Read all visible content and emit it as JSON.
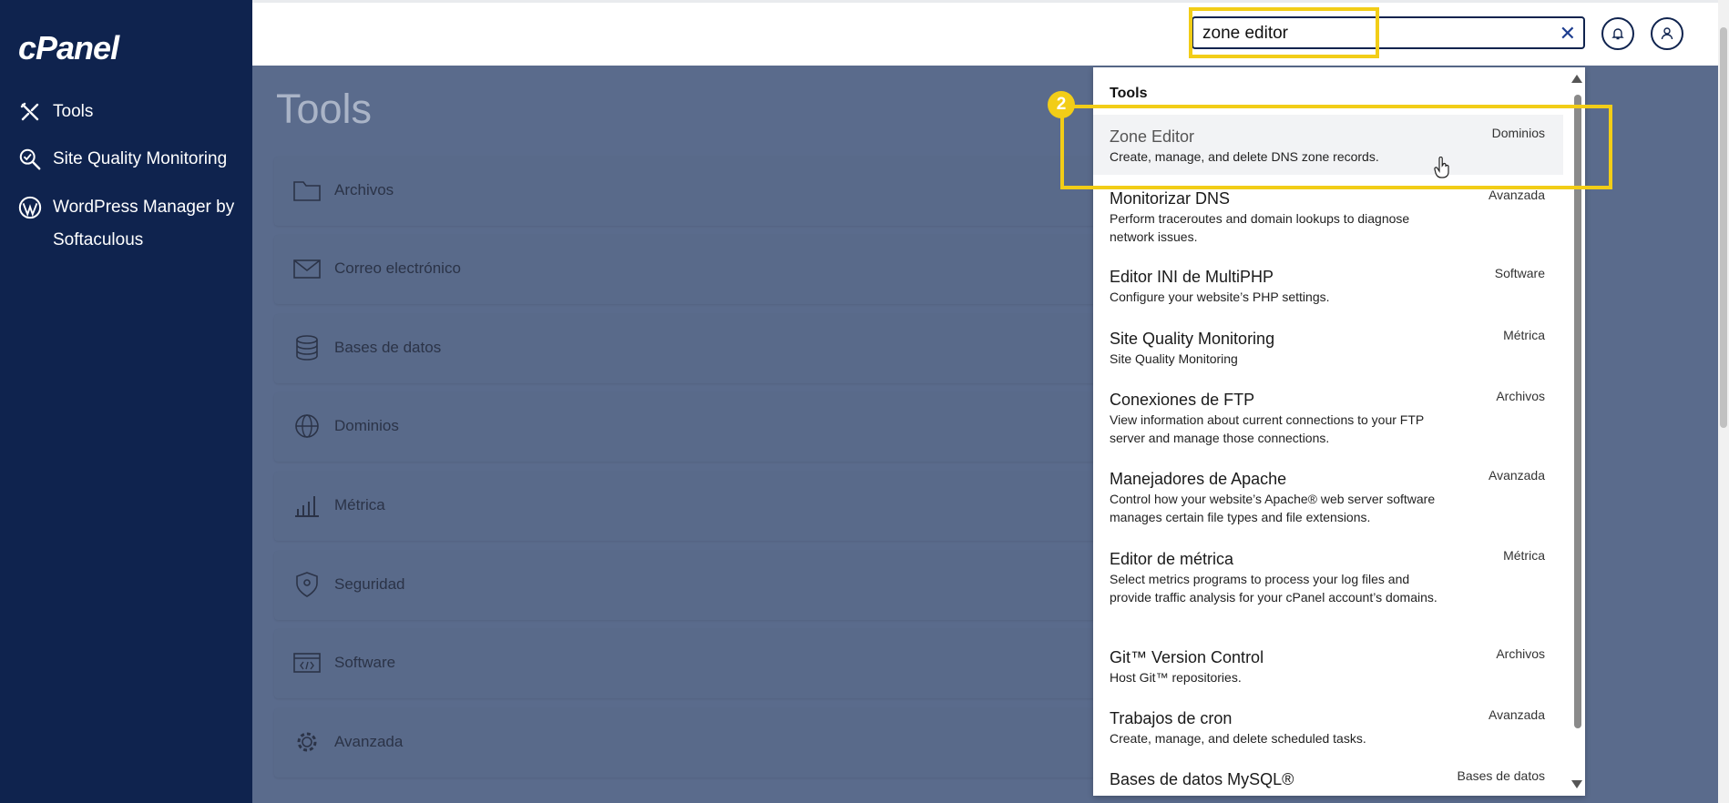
{
  "brand": {
    "logo": "cPanel"
  },
  "sidebar": {
    "items": [
      {
        "label": "Tools",
        "icon": "tools-icon"
      },
      {
        "label": "Site Quality Monitoring",
        "icon": "magnifier-check-icon"
      },
      {
        "label": "WordPress Manager by Softaculous",
        "icon": "wordpress-icon"
      }
    ]
  },
  "search": {
    "value": "zone editor",
    "placeholder": ""
  },
  "main": {
    "title": "Tools",
    "sections": [
      {
        "label": "Archivos",
        "icon": "folder-icon"
      },
      {
        "label": "Correo electrónico",
        "icon": "envelope-icon"
      },
      {
        "label": "Bases de datos",
        "icon": "database-icon"
      },
      {
        "label": "Dominios",
        "icon": "globe-icon"
      },
      {
        "label": "Métrica",
        "icon": "bar-chart-icon"
      },
      {
        "label": "Seguridad",
        "icon": "shield-icon"
      },
      {
        "label": "Software",
        "icon": "code-window-icon"
      },
      {
        "label": "Avanzada",
        "icon": "gear-icon"
      }
    ]
  },
  "dropdown": {
    "heading": "Tools",
    "items": [
      {
        "title": "Zone Editor",
        "desc": "Create, manage, and delete DNS zone records.",
        "category": "Dominios"
      },
      {
        "title": "Monitorizar DNS",
        "desc": "Perform traceroutes and domain lookups to diagnose network issues.",
        "category": "Avanzada"
      },
      {
        "title": "Editor INI de MultiPHP",
        "desc": "Configure your website’s PHP settings.",
        "category": "Software"
      },
      {
        "title": "Site Quality Monitoring",
        "desc": "Site Quality Monitoring",
        "category": "Métrica"
      },
      {
        "title": "Conexiones de FTP",
        "desc": "View information about current connections to your FTP server and manage those connections.",
        "category": "Archivos"
      },
      {
        "title": "Manejadores de Apache",
        "desc": "Control how your website’s Apache® web server software manages certain file types and file extensions.",
        "category": "Avanzada"
      },
      {
        "title": "Editor de métrica",
        "desc": "Select metrics programs to process your log files and provide traffic analysis for your cPanel account’s domains.",
        "category": "Métrica"
      },
      {
        "title": "Git™ Version Control",
        "desc": "Host Git™ repositories.",
        "category": "Archivos"
      },
      {
        "title": "Trabajos de cron",
        "desc": "Create, manage, and delete scheduled tasks.",
        "category": "Avanzada"
      },
      {
        "title": "Bases de datos MySQL®",
        "desc": "",
        "category": "Bases de datos"
      }
    ]
  },
  "annotation": {
    "step": "2"
  },
  "colors": {
    "sidebar": "#0f234e",
    "highlight": "#f2cd17",
    "overlay": "#5a6b8c"
  }
}
